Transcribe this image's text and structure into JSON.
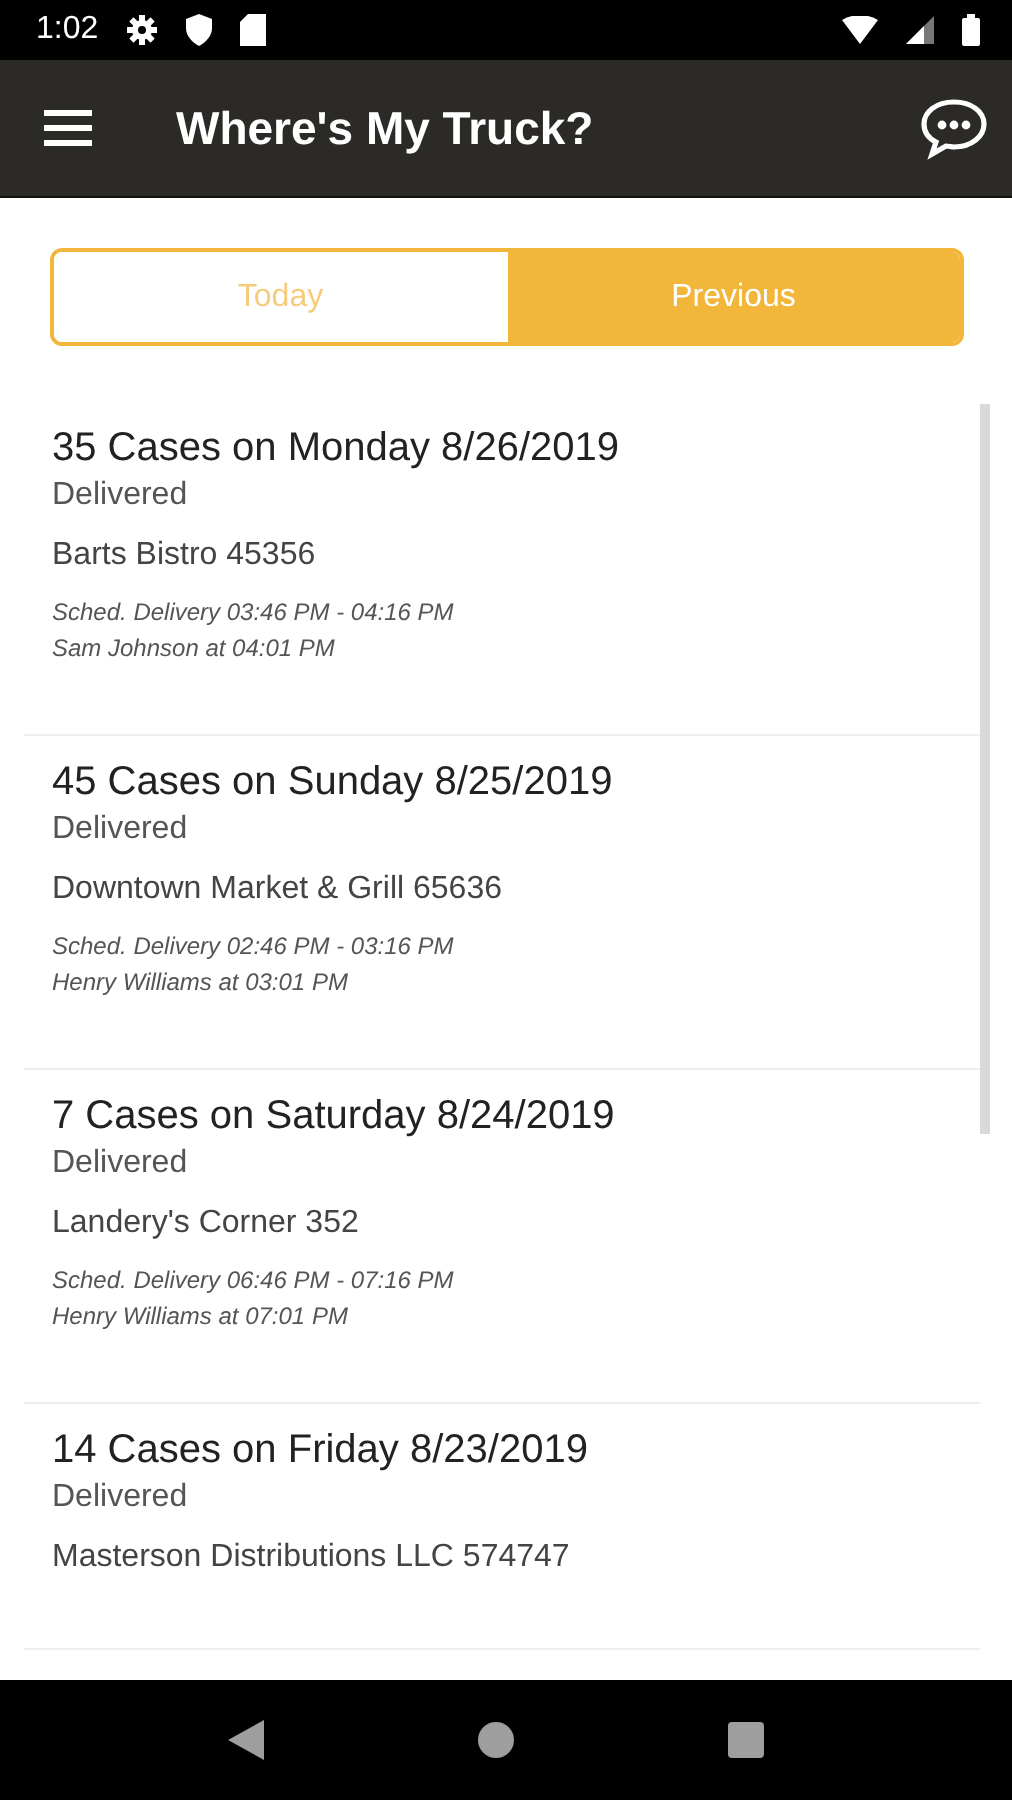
{
  "status_bar": {
    "time": "1:02"
  },
  "app_bar": {
    "title": "Where's My Truck?"
  },
  "tabs": [
    {
      "label": "Today",
      "selected": false
    },
    {
      "label": "Previous",
      "selected": true
    }
  ],
  "deliveries": [
    {
      "title": "35 Cases on Monday 8/26/2019",
      "status": "Delivered",
      "customer": "Barts Bistro 45356",
      "schedule": "Sched. Delivery 03:46 PM - 04:16 PM",
      "driver": "Sam Johnson at 04:01 PM"
    },
    {
      "title": "45 Cases on Sunday 8/25/2019",
      "status": "Delivered",
      "customer": "Downtown Market & Grill 65636",
      "schedule": "Sched. Delivery 02:46 PM - 03:16 PM",
      "driver": "Henry Williams at 03:01 PM"
    },
    {
      "title": "7 Cases on Saturday 8/24/2019",
      "status": "Delivered",
      "customer": "Landery's Corner 352",
      "schedule": "Sched. Delivery 06:46 PM - 07:16 PM",
      "driver": "Henry Williams at 07:01 PM"
    },
    {
      "title": "14 Cases on Friday 8/23/2019",
      "status": "Delivered",
      "customer": "Masterson Distributions LLC 574747"
    }
  ]
}
